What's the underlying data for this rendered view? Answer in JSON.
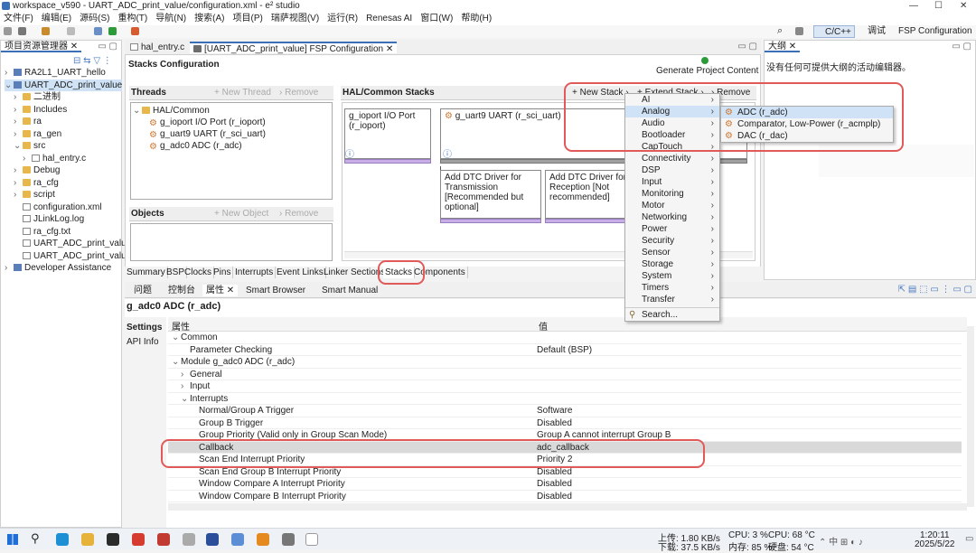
{
  "window": {
    "title": "workspace_v590 - UART_ADC_print_value/configuration.xml - e² studio",
    "controls": [
      "—",
      "☐",
      "✕"
    ]
  },
  "menu": [
    "文件(F)",
    "编辑(E)",
    "源码(S)",
    "重构(T)",
    "导航(N)",
    "搜索(A)",
    "项目(P)",
    "瑞萨视图(V)",
    "运行(R)",
    "Renesas AI",
    "窗口(W)",
    "帮助(H)"
  ],
  "perspectives": {
    "cc": "C/C++",
    "debug": "调试",
    "fsp": "FSP Configuration"
  },
  "explorer": {
    "title": "项目资源管理器",
    "items": [
      {
        "fold": "›",
        "label": "RA2L1_UART_hello",
        "icon": "proj",
        "indent": 0
      },
      {
        "fold": "⌄",
        "label": "UART_ADC_print_value",
        "icon": "proj",
        "indent": 0,
        "selected": true
      },
      {
        "fold": "›",
        "label": "二进制",
        "icon": "folder",
        "indent": 1
      },
      {
        "fold": "›",
        "label": "Includes",
        "icon": "folder",
        "indent": 1
      },
      {
        "fold": "›",
        "label": "ra",
        "icon": "folder",
        "indent": 1
      },
      {
        "fold": "›",
        "label": "ra_gen",
        "icon": "folder",
        "indent": 1
      },
      {
        "fold": "⌄",
        "label": "src",
        "icon": "folder",
        "indent": 1
      },
      {
        "fold": "›",
        "label": "hal_entry.c",
        "icon": "file",
        "indent": 2
      },
      {
        "fold": "›",
        "label": "Debug",
        "icon": "folder",
        "indent": 1
      },
      {
        "fold": "›",
        "label": "ra_cfg",
        "icon": "folder",
        "indent": 1
      },
      {
        "fold": "›",
        "label": "script",
        "icon": "folder",
        "indent": 1
      },
      {
        "fold": "",
        "label": "configuration.xml",
        "icon": "file",
        "indent": 1
      },
      {
        "fold": "",
        "label": "JLinkLog.log",
        "icon": "file",
        "indent": 1
      },
      {
        "fold": "",
        "label": "ra_cfg.txt",
        "icon": "file",
        "indent": 1
      },
      {
        "fold": "",
        "label": "UART_ADC_print_value I",
        "icon": "file",
        "indent": 1
      },
      {
        "fold": "",
        "label": "UART_ADC_print_value I",
        "icon": "file",
        "indent": 1
      },
      {
        "fold": "›",
        "label": "Developer Assistance",
        "icon": "proj",
        "indent": 0
      }
    ]
  },
  "editor_tabs": [
    "hal_entry.c",
    "[UART_ADC_print_value] FSP Configuration"
  ],
  "stacks": {
    "heading": "Stacks Configuration",
    "generate": "Generate Project Content",
    "threads_title": "Threads",
    "new_thread": "New Thread",
    "remove": "Remove",
    "tree": [
      "HAL/Common",
      "g_ioport I/O Port (r_ioport)",
      "g_uart9 UART (r_sci_uart)",
      "g_adc0 ADC (r_adc)"
    ],
    "objects_title": "Objects",
    "new_object": "New Object",
    "hal_title": "HAL/Common Stacks",
    "new_stack": "New Stack",
    "extend_stack": "Extend Stack",
    "cards": {
      "ioport": "g_ioport I/O Port (r_ioport)",
      "uart": "g_uart9 UART (r_sci_uart)",
      "dtc_tx": "Add DTC Driver for Transmission [Recommended but optional]",
      "dtc_rx": "Add DTC Driver for Reception [Not recommended]"
    }
  },
  "bottom_tabs": [
    "Summary",
    "BSP",
    "Clocks",
    "Pins",
    "Interrupts",
    "Event Links",
    "Linker Sections",
    "Stacks",
    "Components"
  ],
  "new_stack_menu": [
    "AI",
    "Analog",
    "Audio",
    "Bootloader",
    "CapTouch",
    "Connectivity",
    "DSP",
    "Input",
    "Monitoring",
    "Motor",
    "Networking",
    "Power",
    "Security",
    "Sensor",
    "Storage",
    "System",
    "Timers",
    "Transfer"
  ],
  "search_item": "Search...",
  "analog_submenu": [
    "ADC (r_adc)",
    "Comparator, Low-Power (r_acmplp)",
    "DAC (r_dac)"
  ],
  "outline": {
    "title": "大纲",
    "message": "没有任何可提供大纲的活动编辑器。"
  },
  "lower_tabs": [
    "问题",
    "控制台",
    "属性",
    "Smart Browser",
    "Smart Manual"
  ],
  "properties": {
    "title": "g_adc0 ADC (r_adc)",
    "side_tabs": [
      "Settings",
      "API Info"
    ],
    "col_prop": "属性",
    "col_val": "值",
    "rows": [
      {
        "fold": "⌄",
        "k": "Common",
        "v": "",
        "indent": 0
      },
      {
        "fold": "",
        "k": "Parameter Checking",
        "v": "Default (BSP)",
        "indent": 1
      },
      {
        "fold": "⌄",
        "k": "Module g_adc0 ADC (r_adc)",
        "v": "",
        "indent": 0
      },
      {
        "fold": "›",
        "k": "General",
        "v": "",
        "indent": 1
      },
      {
        "fold": "›",
        "k": "Input",
        "v": "",
        "indent": 1
      },
      {
        "fold": "⌄",
        "k": "Interrupts",
        "v": "",
        "indent": 1
      },
      {
        "fold": "",
        "k": "Normal/Group A Trigger",
        "v": "Software",
        "indent": 2
      },
      {
        "fold": "",
        "k": "Group B Trigger",
        "v": "Disabled",
        "indent": 2
      },
      {
        "fold": "",
        "k": "Group Priority (Valid only in Group Scan Mode)",
        "v": "Group A cannot interrupt Group B",
        "indent": 2
      },
      {
        "fold": "",
        "k": "Callback",
        "v": "adc_callback",
        "indent": 2,
        "selected": true
      },
      {
        "fold": "",
        "k": "Scan End Interrupt Priority",
        "v": "Priority 2",
        "indent": 2
      },
      {
        "fold": "",
        "k": "Scan End Group B Interrupt Priority",
        "v": "Disabled",
        "indent": 2
      },
      {
        "fold": "",
        "k": "Window Compare A Interrupt Priority",
        "v": "Disabled",
        "indent": 2
      },
      {
        "fold": "",
        "k": "Window Compare B Interrupt Priority",
        "v": "Disabled",
        "indent": 2
      }
    ]
  },
  "taskbar": {
    "net_up": "上传: 1.80 KB/s",
    "net_down": "下载: 37.5 KB/s",
    "cpu": "CPU: 3 %",
    "cpu_temp": "CPU: 68 °C",
    "mem": "内存: 85 %",
    "disk": "硬盘: 54 °C",
    "time": "1:20:11",
    "date": "2025/5/22"
  }
}
